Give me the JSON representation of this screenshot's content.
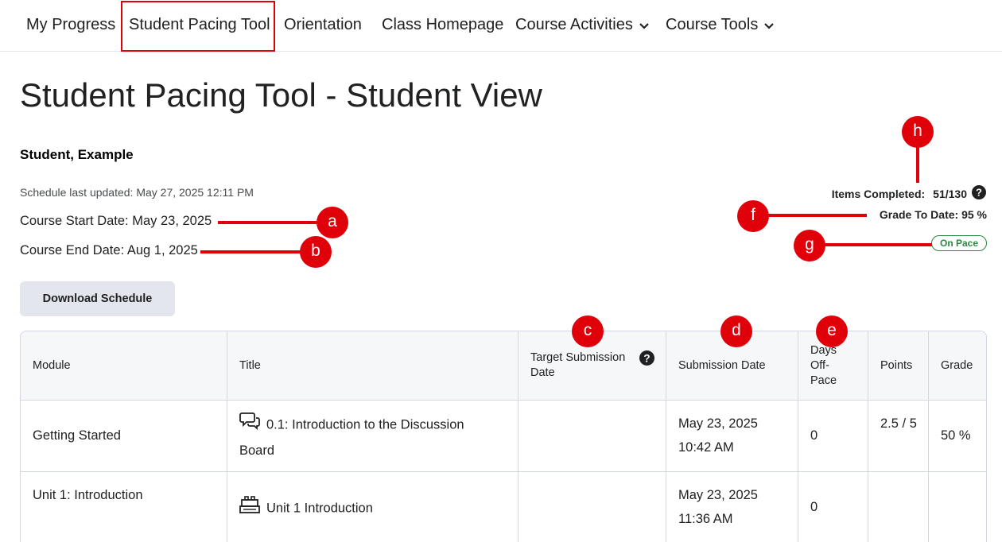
{
  "nav": {
    "items": [
      {
        "label": "My Progress"
      },
      {
        "label": "Student Pacing Tool"
      },
      {
        "label": "Orientation"
      },
      {
        "label": "Class Homepage"
      },
      {
        "label": "Course Activities"
      },
      {
        "label": "Course Tools"
      }
    ]
  },
  "page_title": "Student Pacing Tool - Student View",
  "student_name": "Student, Example",
  "schedule_updated": "Schedule last updated: May 27, 2025 12:11 PM",
  "course_start": "Course Start Date: May 23, 2025",
  "course_end": "Course End Date: Aug 1, 2025",
  "stats": {
    "items_completed_label": "Items Completed:",
    "items_completed_value": "51/130",
    "grade_to_date": "Grade To Date: 95 %",
    "pace_status": "On Pace"
  },
  "download_label": "Download Schedule",
  "table": {
    "headers": [
      "Module",
      "Title",
      "Target Submission Date",
      "Submission Date",
      "Days Off-Pace",
      "Points",
      "Grade"
    ],
    "rows": [
      {
        "module": "Getting Started",
        "title": "0.1: Introduction to the Discussion Board",
        "icon": "discussion-icon",
        "target": "",
        "submission": "May 23, 2025 10:42 AM",
        "days_off": "0",
        "points": "2.5 / 5",
        "grade": "50 %"
      },
      {
        "module": "Unit 1: Introduction",
        "title": "Unit 1 Introduction",
        "icon": "lego-brick-icon",
        "target": "",
        "submission": "May 23, 2025 11:36 AM",
        "days_off": "0",
        "points": "",
        "grade": ""
      }
    ]
  },
  "annotations": [
    "a",
    "b",
    "c",
    "d",
    "e",
    "f",
    "g",
    "h"
  ],
  "colors": {
    "accent_red": "#e0000a",
    "on_pace_green": "#2e8540",
    "button_bg": "#e3e6ed"
  }
}
